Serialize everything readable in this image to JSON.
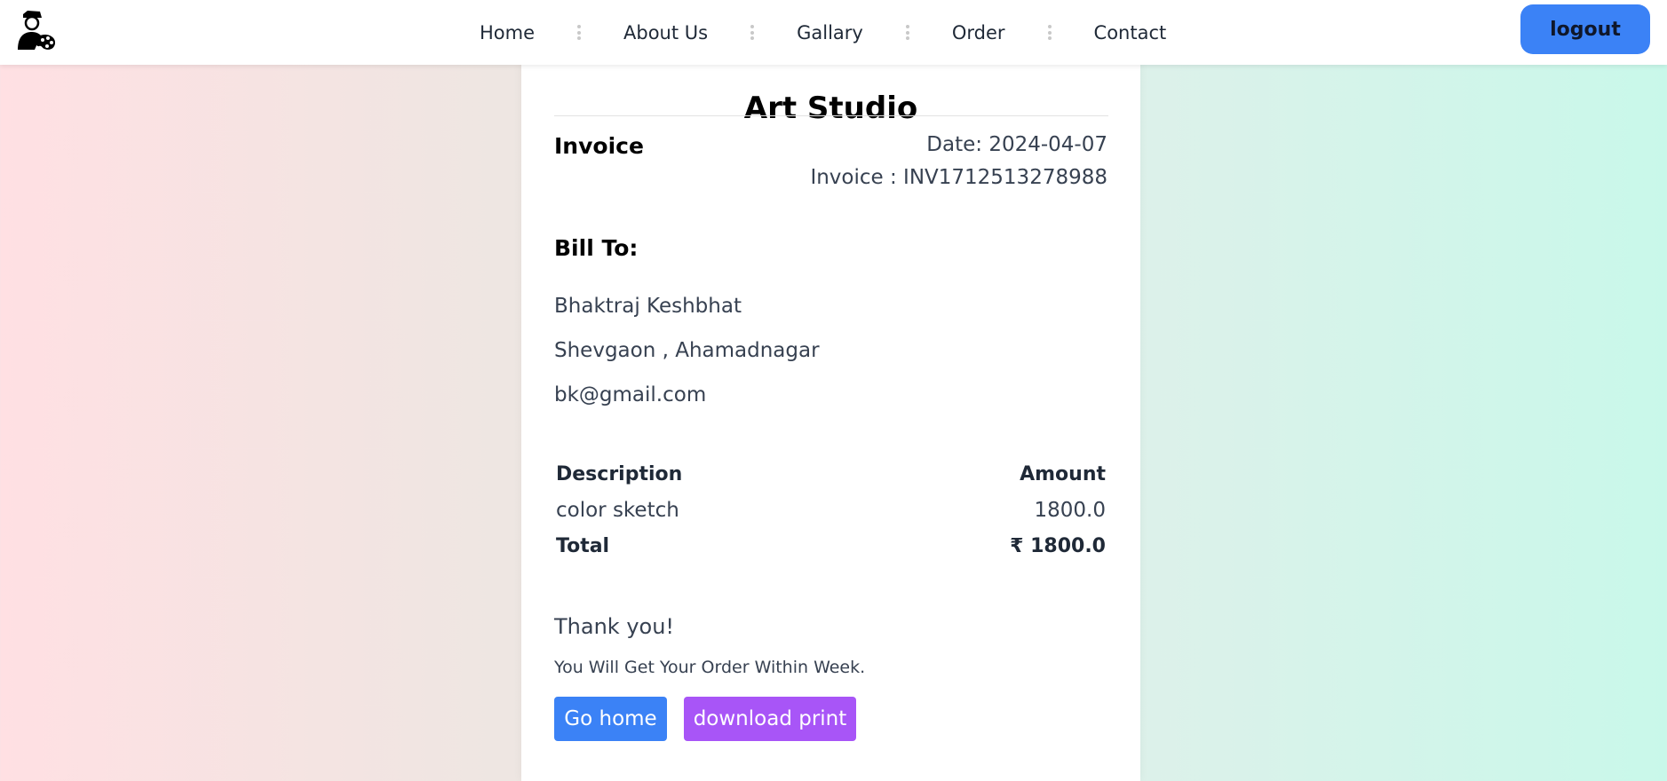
{
  "nav": {
    "links": [
      "Home",
      "About Us",
      "Gallary",
      "Order",
      "Contact"
    ],
    "logout_label": "logout"
  },
  "invoice": {
    "studio_name": "Art Studio",
    "heading": "Invoice",
    "date": "Date: 2024-04-07",
    "number": "Invoice : INV1712513278988",
    "bill_to_heading": "Bill To:",
    "customer": {
      "name": "Bhaktraj Keshbhat",
      "address": "Shevgaon , Ahamadnagar",
      "email": "bk@gmail.com"
    },
    "table": {
      "headers": [
        "Description",
        "Amount"
      ],
      "items": [
        {
          "description": "color sketch",
          "amount": "1800.0"
        }
      ],
      "total_label": "Total",
      "total_value": "₹ 1800.0"
    },
    "thank_you": "Thank you!",
    "note": "You Will Get Your Order Within Week."
  },
  "actions": {
    "home_label": "Go home",
    "print_label": "download print"
  },
  "colors": {
    "primary": "#3b82f6",
    "secondary": "#a855f7"
  }
}
